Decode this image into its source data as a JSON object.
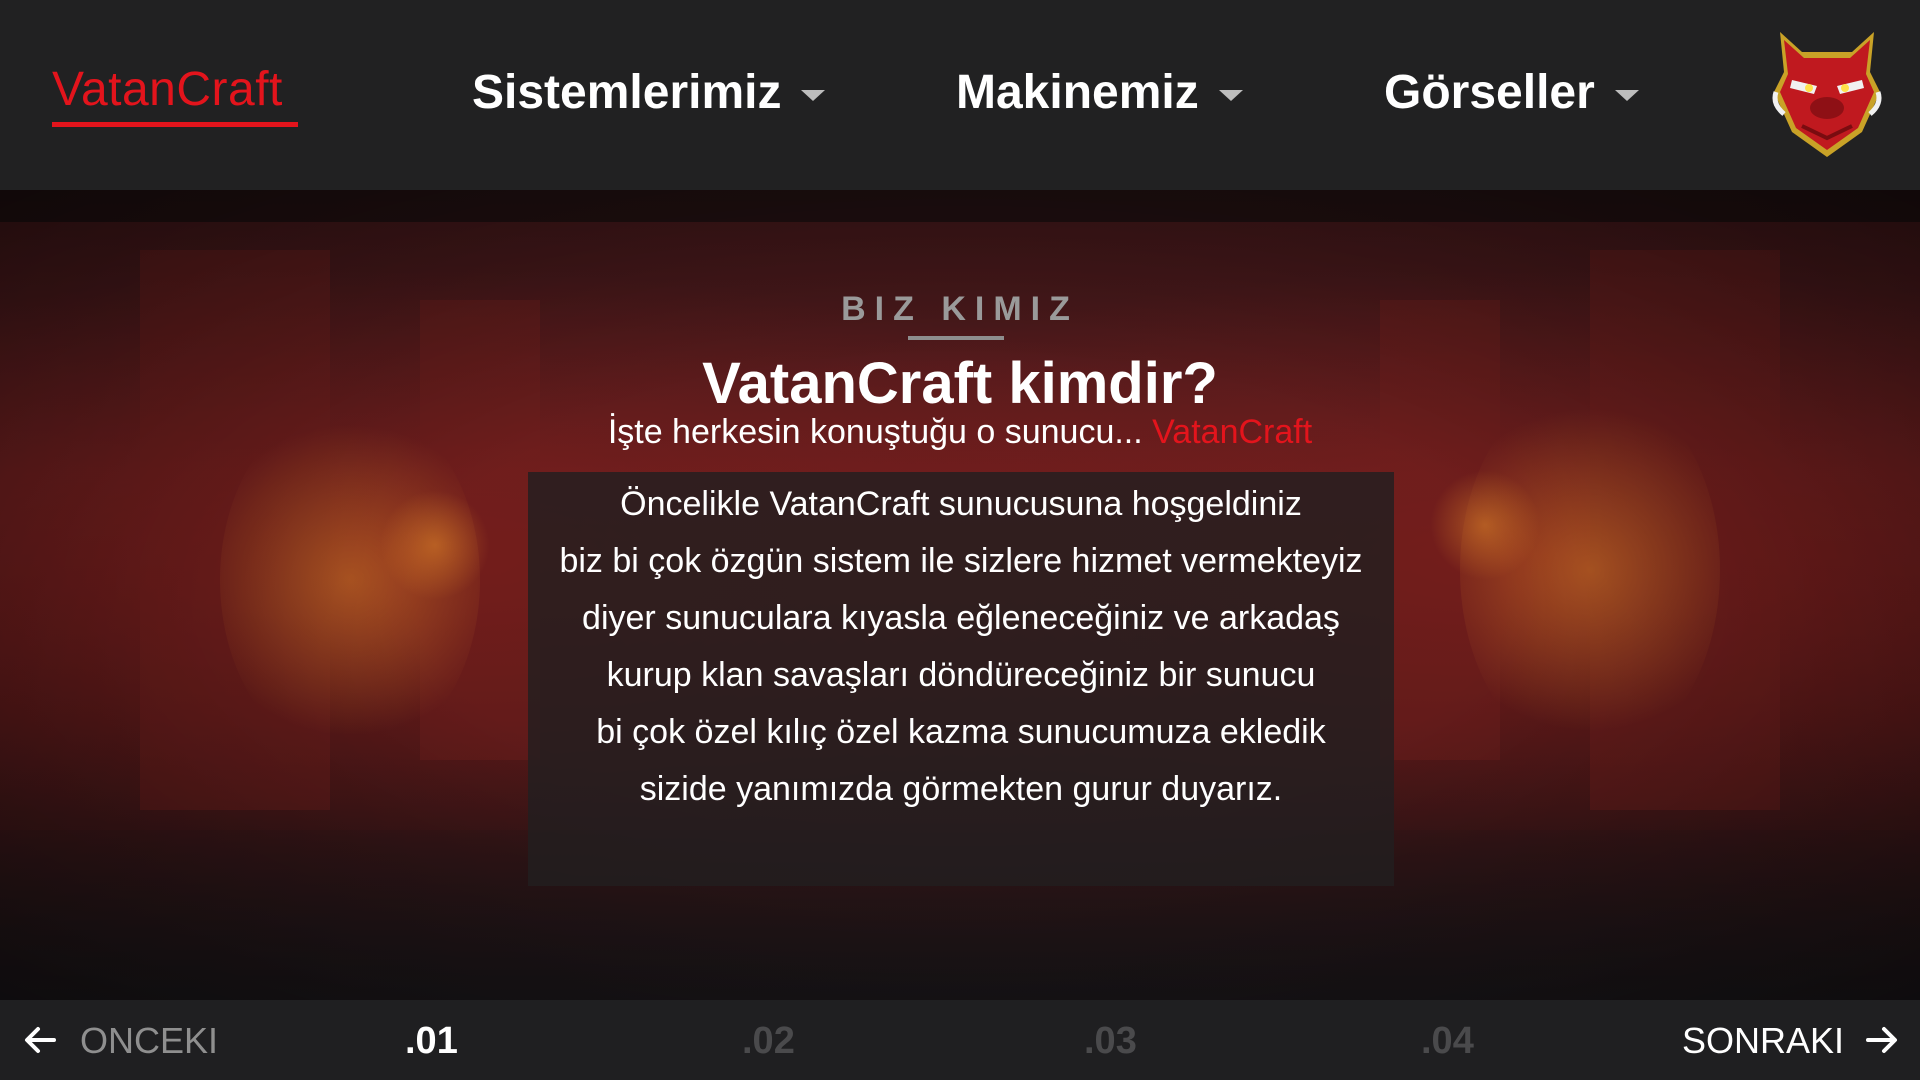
{
  "nav": {
    "brand": "VatanCraft",
    "items": [
      {
        "label": "Sistemlerimiz"
      },
      {
        "label": "Makinemiz"
      },
      {
        "label": "Görseller"
      }
    ],
    "logo_icon": "red-boar-mascot-icon"
  },
  "hero": {
    "eyebrow": "BIZ KIMIZ",
    "title": "VatanCraft kimdir?",
    "tagline_prefix": "İşte herkesin konuştuğu o sunucu... ",
    "tagline_accent": "VatanCraft",
    "body_lines": [
      "Öncelikle VatanCraft sunucusuna hoşgeldiniz",
      "biz bi çok özgün sistem ile sizlere hizmet vermekteyiz",
      "diyer sunuculara kıyasla eğleneceğiniz ve arkadaş",
      "kurup klan savaşları döndüreceğiniz bir sunucu",
      "bi çok özel kılıç özel kazma sunucumuza ekledik",
      "sizide yanımızda görmekten gurur duyarız."
    ]
  },
  "pager": {
    "prev_label": "ONCEKI",
    "next_label": "SONRAKI",
    "pages": [
      ".01",
      ".02",
      ".03",
      ".04"
    ],
    "active_index": 0
  },
  "colors": {
    "accent": "#e3141c",
    "nav_bg": "#212122",
    "bottom_bg": "#1f1f21"
  }
}
